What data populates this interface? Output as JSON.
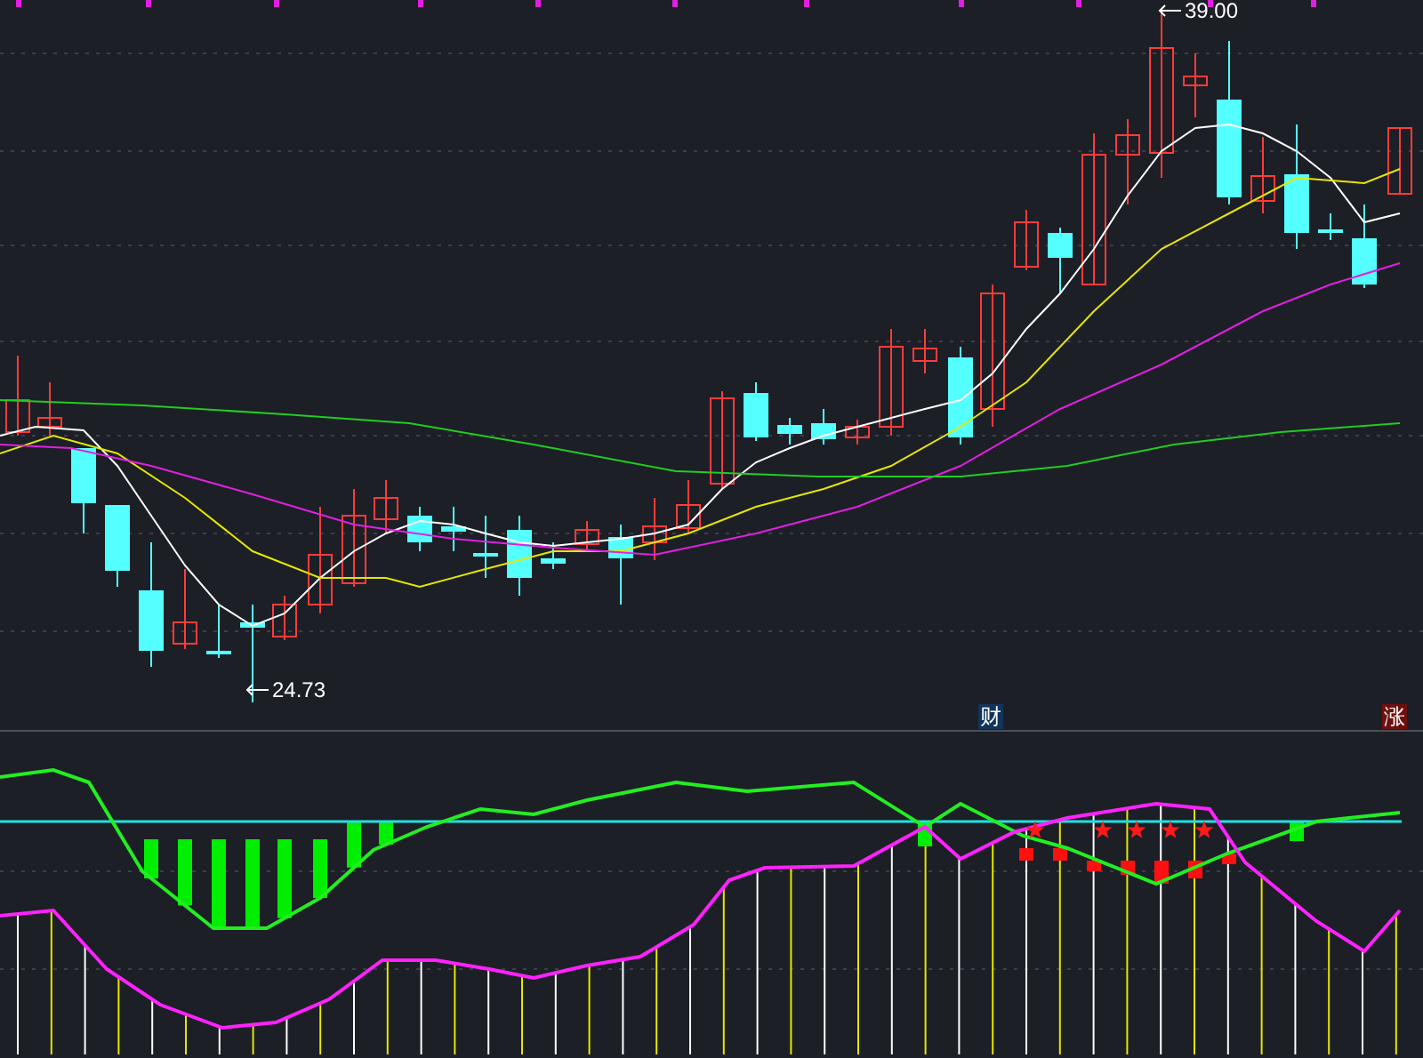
{
  "price_chart": {
    "high_label": "39.00",
    "low_label": "24.73"
  },
  "event_badges": [
    {
      "text": "财",
      "color": "#12345a"
    },
    {
      "text": "涨",
      "color": "#6e0f0f"
    }
  ]
}
